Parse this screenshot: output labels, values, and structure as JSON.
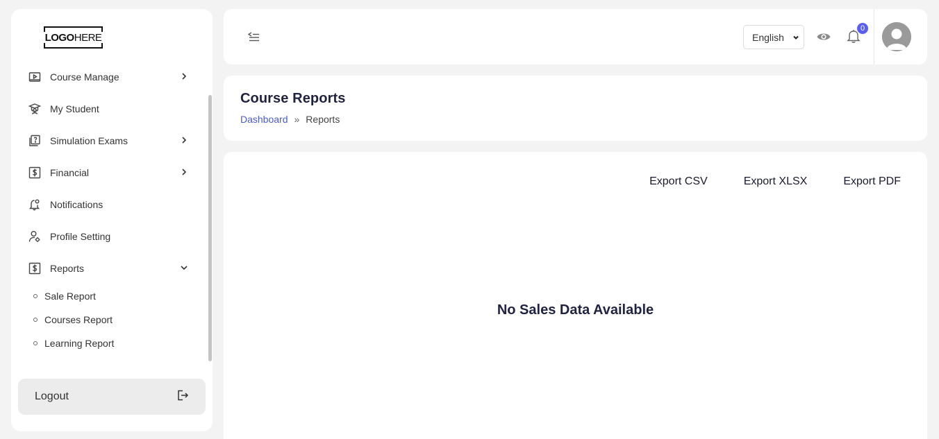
{
  "logo": {
    "bold": "LOGO",
    "light": "HERE"
  },
  "sidebar": {
    "items": [
      {
        "label": "Course Manage",
        "icon": "play-box-icon",
        "has_chevron": true
      },
      {
        "label": "My Student",
        "icon": "graduation-icon",
        "has_chevron": false
      },
      {
        "label": "Simulation Exams",
        "icon": "exam-icon",
        "has_chevron": true
      },
      {
        "label": "Financial",
        "icon": "dollar-box-icon",
        "has_chevron": true
      },
      {
        "label": "Notifications",
        "icon": "bell-icon",
        "has_chevron": false
      },
      {
        "label": "Profile Setting",
        "icon": "user-gear-icon",
        "has_chevron": false
      },
      {
        "label": "Reports",
        "icon": "dollar-box-icon",
        "has_chevron": true,
        "expanded": true
      }
    ],
    "reports_sub": [
      "Sale Report",
      "Courses Report",
      "Learning Report"
    ],
    "logout_label": "Logout"
  },
  "header": {
    "language": "English",
    "notification_count": "0"
  },
  "page": {
    "title": "Course Reports",
    "breadcrumb_home": "Dashboard",
    "breadcrumb_sep": "»",
    "breadcrumb_current": "Reports"
  },
  "content": {
    "export_csv": "Export CSV",
    "export_xlsx": "Export XLSX",
    "export_pdf": "Export PDF",
    "empty_message": "No Sales Data Available"
  },
  "colors": {
    "accent": "#5b5ff0",
    "link": "#4a5bd0",
    "background": "#f3f3f3"
  }
}
